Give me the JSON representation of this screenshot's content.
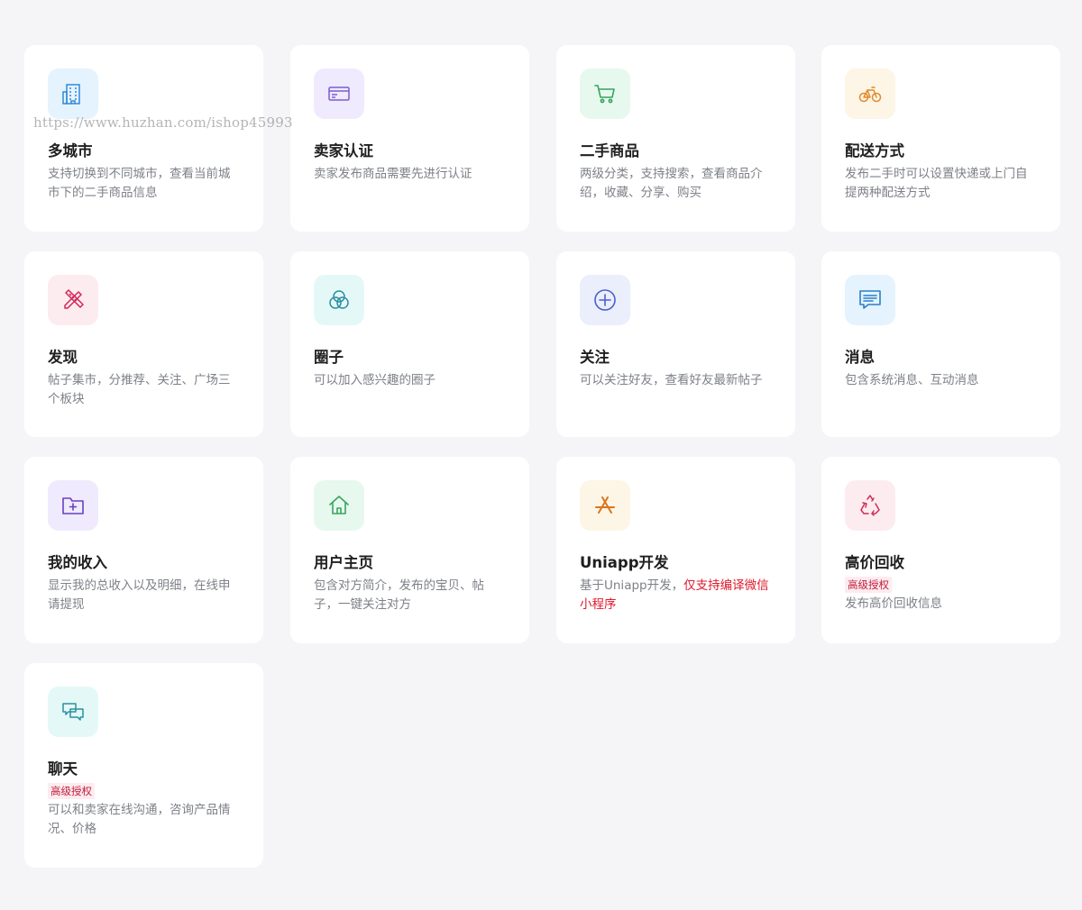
{
  "watermark": "https://www.huzhan.com/ishop45993",
  "features": [
    {
      "id": "multi-city",
      "icon": "building-icon",
      "icon_bg": "#e4f3fd",
      "icon_color": "#2e8ad8",
      "title": "多城市",
      "badge": "",
      "desc": "支持切换到不同城市，查看当前城市下的二手商品信息",
      "desc_red": ""
    },
    {
      "id": "seller-verify",
      "icon": "card-icon",
      "icon_bg": "#efeafd",
      "icon_color": "#7a5cd0",
      "title": "卖家认证",
      "badge": "",
      "desc": "卖家发布商品需要先进行认证",
      "desc_red": ""
    },
    {
      "id": "second-hand-goods",
      "icon": "cart-icon",
      "icon_bg": "#e7f8ee",
      "icon_color": "#33a45d",
      "title": "二手商品",
      "badge": "",
      "desc": "两级分类，支持搜索，查看商品介绍，收藏、分享、购买",
      "desc_red": ""
    },
    {
      "id": "delivery",
      "icon": "bicycle-icon",
      "icon_bg": "#fdf5e6",
      "icon_color": "#e18a2c",
      "title": "配送方式",
      "badge": "",
      "desc": "发布二手时可以设置快递或上门自提两种配送方式",
      "desc_red": ""
    },
    {
      "id": "discover",
      "icon": "pencil-ruler-icon",
      "icon_bg": "#fdecef",
      "icon_color": "#d12657",
      "title": "发现",
      "badge": "",
      "desc": "帖子集市，分推荐、关注、广场三个板块",
      "desc_red": ""
    },
    {
      "id": "circle",
      "icon": "circles-icon",
      "icon_bg": "#e5f8f8",
      "icon_color": "#2a8fa0",
      "title": "圈子",
      "badge": "",
      "desc": "可以加入感兴趣的圈子",
      "desc_red": ""
    },
    {
      "id": "follow",
      "icon": "plus-circle-icon",
      "icon_bg": "#ebeefb",
      "icon_color": "#4a5fd0",
      "title": "关注",
      "badge": "",
      "desc": "可以关注好友，查看好友最新帖子",
      "desc_red": ""
    },
    {
      "id": "messages",
      "icon": "message-icon",
      "icon_bg": "#e4f3fd",
      "icon_color": "#2a7fc8",
      "title": "消息",
      "badge": "",
      "desc": "包含系统消息、互动消息",
      "desc_red": ""
    },
    {
      "id": "my-income",
      "icon": "folder-plus-icon",
      "icon_bg": "#efeafd",
      "icon_color": "#6a3fc2",
      "title": "我的收入",
      "badge": "",
      "desc": "显示我的总收入以及明细，在线申请提现",
      "desc_red": ""
    },
    {
      "id": "user-home",
      "icon": "home-icon",
      "icon_bg": "#e7f8ee",
      "icon_color": "#3aa55e",
      "title": "用户主页",
      "badge": "",
      "desc": "包含对方简介，发布的宝贝、帖子，一键关注对方",
      "desc_red": ""
    },
    {
      "id": "uniapp",
      "icon": "app-store-icon",
      "icon_bg": "#fdf5e6",
      "icon_color": "#d9761e",
      "title": "Uniapp开发",
      "badge": "",
      "desc": "基于Uniapp开发，",
      "desc_red": "仅支持编译微信小程序"
    },
    {
      "id": "recycle",
      "icon": "recycle-icon",
      "icon_bg": "#fdecef",
      "icon_color": "#cf2d58",
      "title": "高价回收",
      "badge": "高级授权",
      "desc": "发布高价回收信息",
      "desc_red": ""
    },
    {
      "id": "chat",
      "icon": "chat-icon",
      "icon_bg": "#e5f8f8",
      "icon_color": "#2a8fa0",
      "title": "聊天",
      "badge": "高级授权",
      "desc": "可以和卖家在线沟通，咨询产品情况、价格",
      "desc_red": ""
    }
  ]
}
